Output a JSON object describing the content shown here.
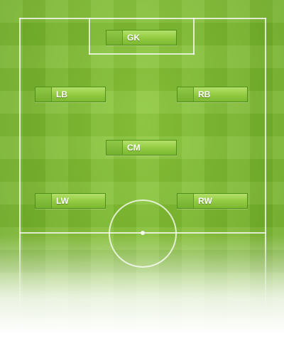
{
  "pitch": {
    "grass_color": "#7cb82f",
    "line_color": "#ffffff"
  },
  "formation": {
    "positions": [
      {
        "id": "gk",
        "label": "GK"
      },
      {
        "id": "lb",
        "label": "LB"
      },
      {
        "id": "rb",
        "label": "RB"
      },
      {
        "id": "cm",
        "label": "CM"
      },
      {
        "id": "lw",
        "label": "LW"
      },
      {
        "id": "rw",
        "label": "RW"
      }
    ]
  }
}
